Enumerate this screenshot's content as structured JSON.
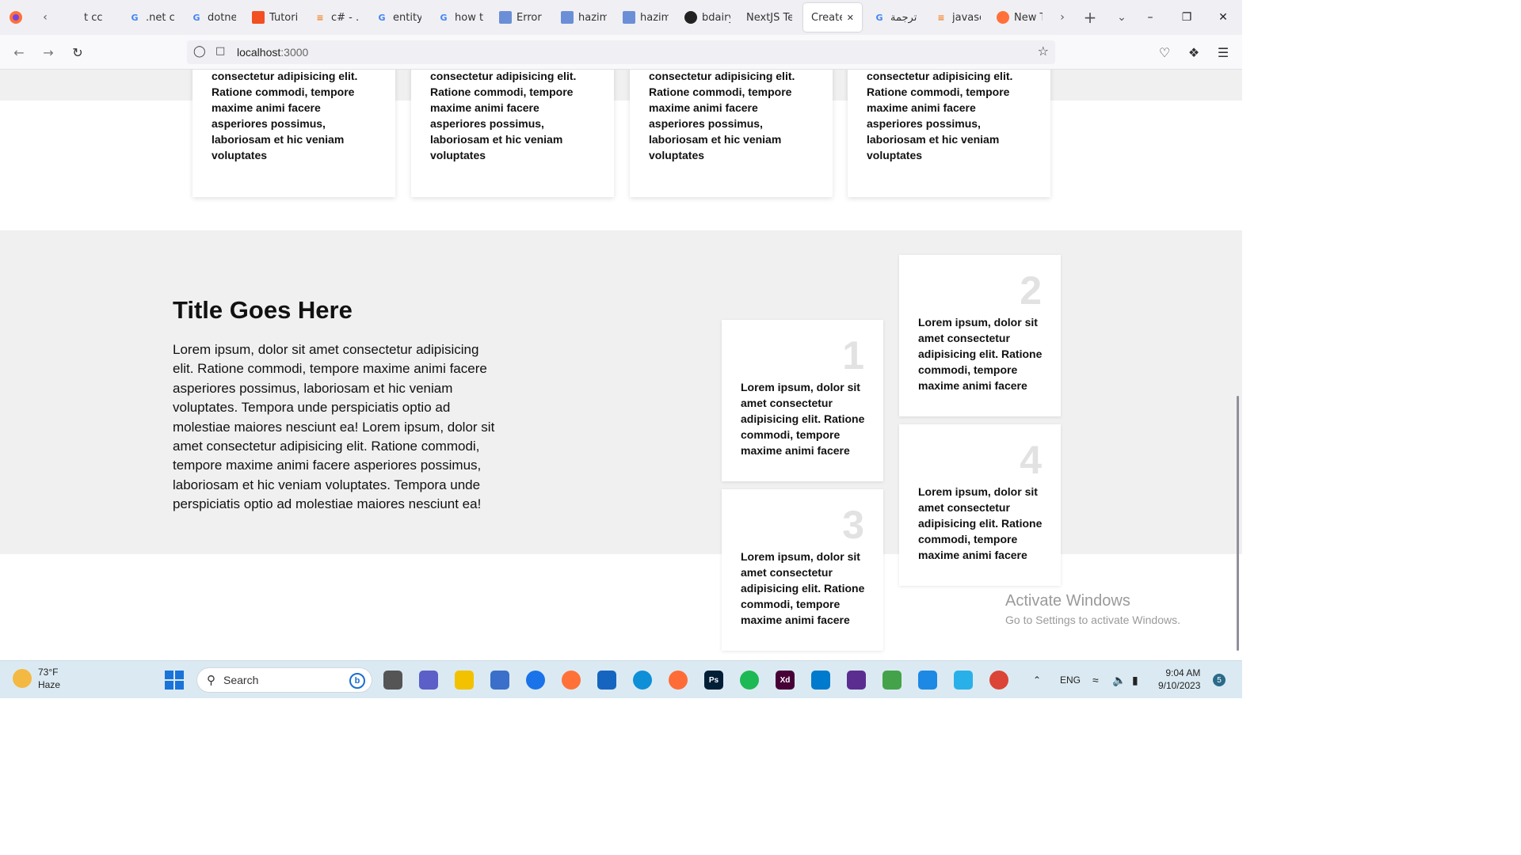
{
  "browser": {
    "tabs": [
      {
        "label": "t cc",
        "icon": "tab-page-icon"
      },
      {
        "label": ".net cc",
        "icon": "google-icon"
      },
      {
        "label": "dotne",
        "icon": "google-icon"
      },
      {
        "label": "Tutori",
        "icon": "microsoft-icon"
      },
      {
        "label": "c# - .N",
        "icon": "stackoverflow-icon"
      },
      {
        "label": "entity",
        "icon": "google-icon"
      },
      {
        "label": "how tc",
        "icon": "google-icon"
      },
      {
        "label": "Error -",
        "icon": "doc-icon"
      },
      {
        "label": "hazim",
        "icon": "doc-icon"
      },
      {
        "label": "hazim",
        "icon": "doc-icon"
      },
      {
        "label": "bdairy",
        "icon": "github-icon"
      },
      {
        "label": "NextJS Tes",
        "icon": "none"
      },
      {
        "label": "Create",
        "icon": "none",
        "active": true
      },
      {
        "label": "ترجمة",
        "icon": "translate-icon"
      },
      {
        "label": "javasc",
        "icon": "stackoverflow-icon"
      },
      {
        "label": "New T",
        "icon": "firefox-icon"
      }
    ],
    "url": {
      "host": "localhost",
      "port": ":3000"
    }
  },
  "page": {
    "top_cards": [
      {
        "text": "consectetur adipisicing elit. Ratione commodi, tempore maxime animi facere asperiores possimus, laboriosam et hic veniam voluptates"
      },
      {
        "text": "consectetur adipisicing elit. Ratione commodi, tempore maxime animi facere asperiores possimus, laboriosam et hic veniam voluptates"
      },
      {
        "text": "consectetur adipisicing elit. Ratione commodi, tempore maxime animi facere asperiores possimus, laboriosam et hic veniam voluptates"
      },
      {
        "text": "consectetur adipisicing elit. Ratione commodi, tempore maxime animi facere asperiores possimus, laboriosam et hic veniam voluptates"
      }
    ],
    "section_title": "Title Goes Here",
    "section_text": "Lorem ipsum, dolor sit amet consectetur adipisicing elit. Ratione commodi, tempore maxime animi facere asperiores possimus, laboriosam et hic veniam voluptates. Tempora unde perspiciatis optio ad molestiae maiores nesciunt ea! Lorem ipsum, dolor sit amet consectetur adipisicing elit. Ratione commodi, tempore maxime animi facere asperiores possimus, laboriosam et hic veniam voluptates. Tempora unde perspiciatis optio ad molestiae maiores nesciunt ea!",
    "feature_cards": [
      {
        "number": "1",
        "text": "Lorem ipsum, dolor sit amet consectetur adipisicing elit. Ratione commodi, tempore maxime animi facere"
      },
      {
        "number": "2",
        "text": "Lorem ipsum, dolor sit amet consectetur adipisicing elit. Ratione commodi, tempore maxime animi facere"
      },
      {
        "number": "3",
        "text": "Lorem ipsum, dolor sit amet consectetur adipisicing elit. Ratione commodi, tempore maxime animi facere"
      },
      {
        "number": "4",
        "text": "Lorem ipsum, dolor sit amet consectetur adipisicing elit. Ratione commodi, tempore maxime animi facere"
      }
    ]
  },
  "watermark": {
    "line1": "Activate Windows",
    "line2": "Go to Settings to activate Windows."
  },
  "taskbar": {
    "weather_temp": "73°F",
    "weather_desc": "Haze",
    "search_placeholder": "Search",
    "bing_label": "b",
    "language": "ENG",
    "time": "9:04 AM",
    "date": "9/10/2023",
    "notification_count": "5",
    "apps": [
      {
        "name": "task-view-icon",
        "label": ""
      },
      {
        "name": "teams-icon",
        "label": ""
      },
      {
        "name": "file-explorer-icon",
        "label": ""
      },
      {
        "name": "store-icon",
        "label": ""
      },
      {
        "name": "chrome-icon",
        "label": ""
      },
      {
        "name": "firefox-icon",
        "label": ""
      },
      {
        "name": "mail-icon",
        "label": ""
      },
      {
        "name": "edge-icon",
        "label": ""
      },
      {
        "name": "postman-icon",
        "label": ""
      },
      {
        "name": "photoshop-icon",
        "label": "Ps"
      },
      {
        "name": "spotify-icon",
        "label": ""
      },
      {
        "name": "xd-icon",
        "label": "Xd"
      },
      {
        "name": "vscode-icon",
        "label": ""
      },
      {
        "name": "visual-studio-icon",
        "label": ""
      },
      {
        "name": "app-icon",
        "label": ""
      },
      {
        "name": "photos-icon",
        "label": ""
      },
      {
        "name": "music-icon",
        "label": ""
      },
      {
        "name": "chrome-profile-icon",
        "label": ""
      }
    ]
  }
}
